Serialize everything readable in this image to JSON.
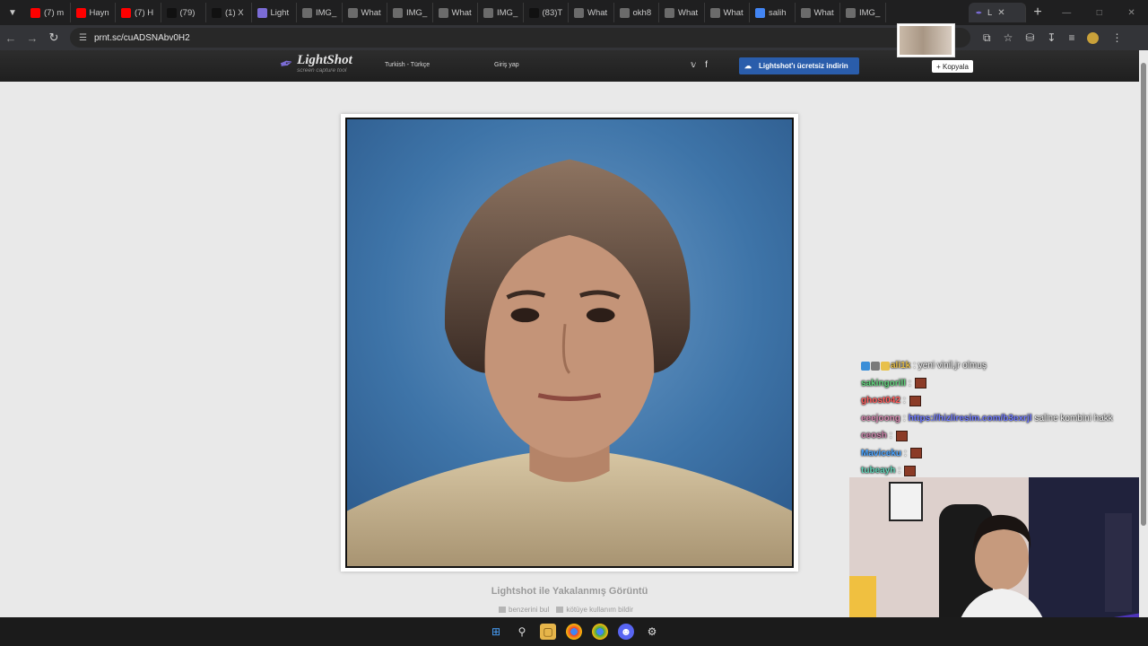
{
  "browser": {
    "tabs": [
      {
        "label": "(7) m",
        "icon": "youtube-icon",
        "color": "#ff0000"
      },
      {
        "label": "Hayn",
        "icon": "youtube-icon",
        "color": "#ff0000"
      },
      {
        "label": "(7) H",
        "icon": "youtube-icon",
        "color": "#ff0000"
      },
      {
        "label": "(79)",
        "icon": "tiktok-icon",
        "color": "#111111"
      },
      {
        "label": "(1) X",
        "icon": "x-icon",
        "color": "#111111"
      },
      {
        "label": "Light",
        "icon": "lightshot-icon",
        "color": "#7b6cd6"
      },
      {
        "label": "IMG_",
        "icon": "globe-icon",
        "color": "#6b6b6b"
      },
      {
        "label": "What",
        "icon": "globe-icon",
        "color": "#6b6b6b"
      },
      {
        "label": "IMG_",
        "icon": "globe-icon",
        "color": "#6b6b6b"
      },
      {
        "label": "What",
        "icon": "globe-icon",
        "color": "#6b6b6b"
      },
      {
        "label": "IMG_",
        "icon": "globe-icon",
        "color": "#6b6b6b"
      },
      {
        "label": "(83)T",
        "icon": "tiktok-icon",
        "color": "#111111"
      },
      {
        "label": "What",
        "icon": "globe-icon",
        "color": "#6b6b6b"
      },
      {
        "label": "okh8",
        "icon": "globe-icon",
        "color": "#6b6b6b"
      },
      {
        "label": "What",
        "icon": "globe-icon",
        "color": "#6b6b6b"
      },
      {
        "label": "What",
        "icon": "globe-icon",
        "color": "#6b6b6b"
      },
      {
        "label": "salih",
        "icon": "google-icon",
        "color": "#4285f4"
      },
      {
        "label": "What",
        "icon": "globe-icon",
        "color": "#6b6b6b"
      },
      {
        "label": "IMG_",
        "icon": "globe-icon",
        "color": "#6b6b6b"
      }
    ],
    "active_tab": {
      "label": "L",
      "icon": "lightshot-icon"
    },
    "url": "prnt.sc/cuADSNAbv0H2"
  },
  "lightshot": {
    "brand": "LightShot",
    "tagline": "screen capture tool",
    "language": "Turkish - Türkçe",
    "login": "Giriş yap",
    "download": "Lightshot'ı ücretsiz indirin",
    "copy_tooltip": "+ Kopyala",
    "caption": "Lightshot ile Yakalanmış Görüntü",
    "find_similar": "benzerini bul",
    "report": "kötüye kullanım bildir"
  },
  "chat": [
    {
      "user": "ali1k",
      "color": "#e8c04a",
      "message": ": yeni vinil,jr olmuş",
      "emote": false,
      "badges": true
    },
    {
      "user": "sakingorill",
      "color": "#5fd17a",
      "message": ":",
      "emote": true
    },
    {
      "user": "ghost042",
      "color": "#ff5a5a",
      "message": ":",
      "emote": true
    },
    {
      "user": "eeejoong",
      "color": "#d88ab2",
      "message": ":",
      "link": "https://hizliresim.com/b3exrjl",
      "suffix": "saline kombini hakk",
      "emote": false
    },
    {
      "user": "ceosh",
      "color": "#c97fa8",
      "message": ":",
      "emote": true
    },
    {
      "user": "Maviceku",
      "color": "#4aa3ff",
      "message": ":",
      "emote": true
    },
    {
      "user": "tubeayh",
      "color": "#5fd1b5",
      "message": ":",
      "emote": true
    }
  ]
}
